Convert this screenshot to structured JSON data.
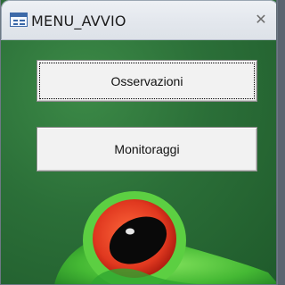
{
  "window": {
    "title": "MENU_AVVIO",
    "icon": "form-icon",
    "close_icon": "close-icon",
    "close_glyph": "✕"
  },
  "buttons": {
    "observations_label": "Osservazioni",
    "monitoring_label": "Monitoraggi"
  },
  "background": {
    "image": "green-frog-photo",
    "colors": {
      "green": "#2b6f38",
      "frog_eye": "#e23b24",
      "frog_skin": "#4fc23b"
    }
  }
}
